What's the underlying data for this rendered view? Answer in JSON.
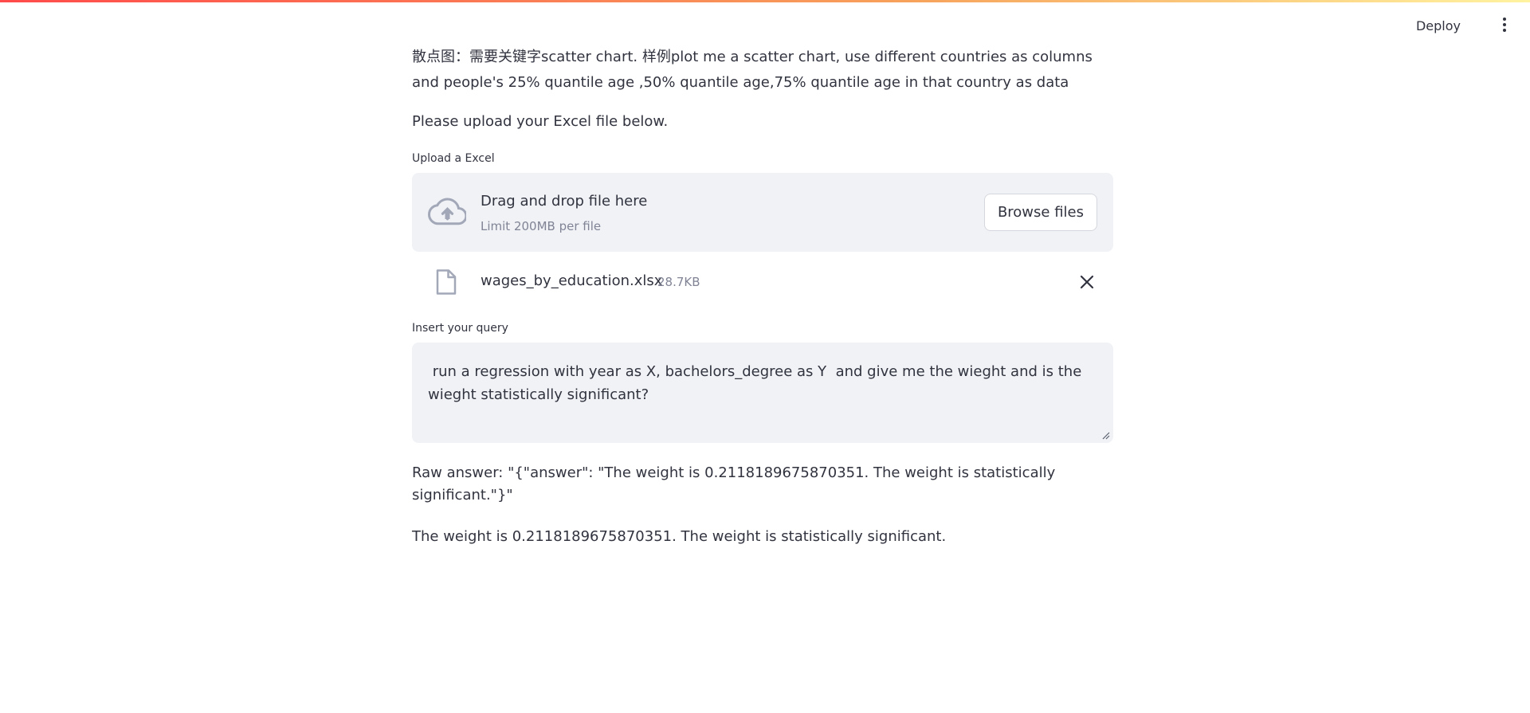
{
  "header": {
    "deploy_label": "Deploy",
    "menu_icon": "kebab-menu-icon"
  },
  "intro": {
    "text": "散点图：需要关键字scatter chart. 样例plot me a scatter chart, use different countries as columns and people's 25% quantile age ,50% quantile age,75% quantile age in that country as data"
  },
  "instructions": "Please upload your Excel file below.",
  "uploader": {
    "label": "Upload a Excel",
    "drop_title": "Drag and drop file here",
    "limit_text": "Limit 200MB per file",
    "browse_label": "Browse files",
    "icon": "cloud-upload-icon"
  },
  "uploaded_file": {
    "name": "wages_by_education.xlsx",
    "size": "28.7KB",
    "icon": "file-icon",
    "remove_icon": "close-icon"
  },
  "query": {
    "label": "Insert your query",
    "value": " run a regression with year as X, bachelors_degree as Y  and give me the wieght and is the wieght statistically significant?"
  },
  "result": {
    "raw_answer": "Raw answer: \"{\"answer\": \"The weight is 0.2118189675870351. The weight is statistically significant.\"}\"",
    "answer": "The weight is 0.2118189675870351. The weight is statistically significant."
  },
  "colors": {
    "text": "#31333f",
    "muted": "#808495",
    "surface": "#f0f2f6",
    "accent_stripe_start": "#ff4b4b",
    "accent_stripe_end": "#fff3a0"
  }
}
